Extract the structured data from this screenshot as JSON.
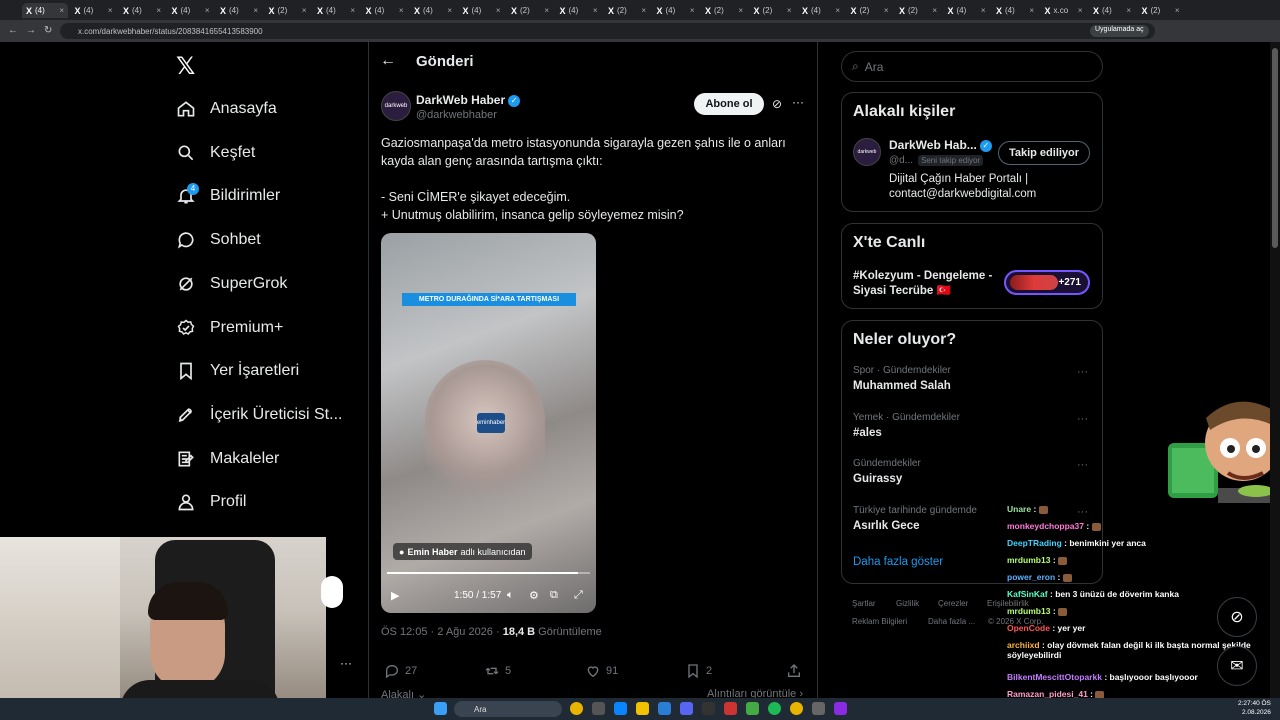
{
  "browser": {
    "tabs": [
      "(4)",
      "(4)",
      "(4)",
      "(4)",
      "(4)",
      "(2)",
      "(4)",
      "(4)",
      "(4)",
      "(4)",
      "(2)",
      "(4)",
      "(2)",
      "(4)",
      "(2)",
      "(2)",
      "(4)",
      "(2)",
      "(2)",
      "(4)",
      "(4)",
      "x.co",
      "(4)",
      "(2)"
    ],
    "url": "x.com/darkwebhaber/status/2083841655413583900",
    "app_badge": "Uygulamada aç"
  },
  "nav": {
    "items": [
      "Anasayfa",
      "Keşfet",
      "Bildirimler",
      "Sohbet",
      "SuperGrok",
      "Premium+",
      "Yer İşaretleri",
      "İçerik Üreticisi St...",
      "Makaleler",
      "Profil"
    ],
    "notification_count": "4"
  },
  "post": {
    "header": "Gönderi",
    "author_name": "DarkWeb Haber",
    "author_handle": "@darkwebhaber",
    "avatar_text": "darkweb",
    "subscribe": "Abone ol",
    "text_lines": [
      "Gaziosmanpaşa'da metro istasyonunda sigarayla gezen şahıs ile o anları kayda alan genç arasında tartışma çıktı:",
      "",
      "- Seni CİMER'e şikayet edeceğim.",
      "+ Unutmuş olabilirim, insanca gelip söyleyemez misin?"
    ],
    "video": {
      "banner": "METRO DURAĞINDA Sİ*ARA TARTIŞMASI",
      "logo": "eminhaber",
      "user_name": "Emin Haber",
      "user_suffix": "adlı kullanıcıdan",
      "time": "1:50 / 1:57",
      "progress": 0.94
    },
    "timestamp": "ÖS 12:05 · 2 Ağu 2026 · ",
    "views_count": "18,4 B",
    "views_label": " Görüntüleme",
    "actions": {
      "replies": "27",
      "reposts": "5",
      "likes": "91",
      "bookmarks": "2"
    },
    "bottom_left": "Alakalı",
    "bottom_right": "Alıntıları görüntüle"
  },
  "sidebar": {
    "search_placeholder": "Ara",
    "related": {
      "title": "Alakalı kişiler",
      "name": "DarkWeb Hab...",
      "handle": "@d...",
      "follows_you": "Seni takip ediyor",
      "following": "Takip ediliyor",
      "bio": "Dijital Çağın Haber Portalı | contact@darkwebdigital.com"
    },
    "live": {
      "title": "X'te Canlı",
      "event": "#Kolezyum - Dengeleme - Siyasi Tecrübe 🇹🇷",
      "count": "+271"
    },
    "trends": {
      "title": "Neler oluyor?",
      "items": [
        {
          "meta": "Spor · Gündemdekiler",
          "name": "Muhammed Salah"
        },
        {
          "meta": "Yemek · Gündemdekiler",
          "name": "#ales"
        },
        {
          "meta": "Gündemdekiler",
          "name": "Guirassy"
        },
        {
          "meta": "Türkiye tarihinde gündemde",
          "name": "Asırlık Gece"
        }
      ],
      "show_more": "Daha fazla göster"
    },
    "footer": [
      "Şartlar",
      "Gizlilik",
      "Çerezler",
      "Erişilebilirlik",
      "Reklam Bilgileri",
      "Daha fazla ...",
      "© 2026 X Corp."
    ]
  },
  "chat": [
    {
      "user": "Unare",
      "msg": "",
      "color": "#9be3a0"
    },
    {
      "user": "monkeydchoppa37",
      "msg": "",
      "color": "#ff7ad9"
    },
    {
      "user": "DeepTRading",
      "msg": "benimkini yer anca",
      "color": "#3fd4ff"
    },
    {
      "user": "mrdumb13",
      "msg": "",
      "color": "#b5ff6b"
    },
    {
      "user": "power_eron",
      "msg": "",
      "color": "#5ab0ff"
    },
    {
      "user": "KafSinKaf",
      "msg": "ben 3 ünüzü de döverim kanka",
      "color": "#5cffc8"
    },
    {
      "user": "mrdumb13",
      "msg": "",
      "color": "#b5ff6b"
    },
    {
      "user": "OpenCode",
      "msg": "yer yer",
      "color": "#ff5555"
    },
    {
      "user": "archiixd",
      "msg": "olay dövmek falan değil ki ilk başta normal şekilde söyleyebilirdi",
      "color": "#ffb347"
    },
    {
      "user": "BilkentMescittOtoparkk",
      "msg": "başlıyooor başlıyooor",
      "color": "#c47dff"
    },
    {
      "user": "Ramazan_pidesi_41",
      "msg": "",
      "color": "#ff9ec7"
    },
    {
      "user": "monkeydchoppa37",
      "msg": "",
      "color": "#ff7ad9"
    }
  ],
  "taskbar": {
    "search": "Ara",
    "time": "2:27:40 ÖS",
    "date": "2.08.2026"
  },
  "colors": {
    "accent": "#1d9bf0",
    "live": "#7856ff"
  }
}
